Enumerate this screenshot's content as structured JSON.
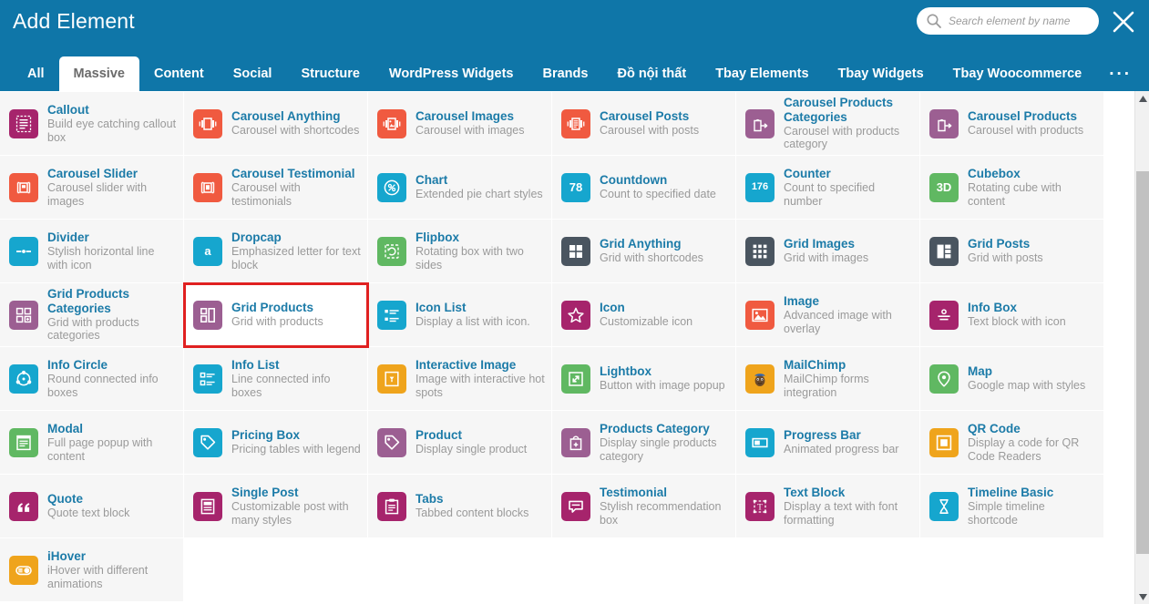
{
  "header": {
    "title": "Add Element",
    "search_placeholder": "Search element by name",
    "search_value": "",
    "close_label": "×",
    "more_tabs_label": "..."
  },
  "tabs": [
    {
      "label": "All",
      "active": false
    },
    {
      "label": "Massive",
      "active": true
    },
    {
      "label": "Content",
      "active": false
    },
    {
      "label": "Social",
      "active": false
    },
    {
      "label": "Structure",
      "active": false
    },
    {
      "label": "WordPress Widgets",
      "active": false
    },
    {
      "label": "Brands",
      "active": false
    },
    {
      "label": "Đồ nội thất",
      "active": false
    },
    {
      "label": "Tbay Elements",
      "active": false
    },
    {
      "label": "Tbay Widgets",
      "active": false
    },
    {
      "label": "Tbay Woocommerce",
      "active": false
    }
  ],
  "colors": {
    "header_blue": "#0f76a8",
    "title_link": "#1c7ba8",
    "desc_gray": "#9a9a9a",
    "selection_red": "#e02020",
    "cell_bg": "#f6f6f6",
    "icon_magenta": "#a6246c",
    "icon_purple": "#9c5f92",
    "icon_orange_red": "#f05a40",
    "icon_cyan": "#16a6ce",
    "icon_green": "#60b862",
    "icon_slate": "#4a5560",
    "icon_amber": "#efa41c"
  },
  "elements": [
    {
      "title": "Callout",
      "desc": "Build eye catching callout box",
      "icon": "callout-icon",
      "color": "#a6246c"
    },
    {
      "title": "Carousel Anything",
      "desc": "Carousel with shortcodes",
      "icon": "carousel-anything-icon",
      "color": "#f05a40"
    },
    {
      "title": "Carousel Images",
      "desc": "Carousel with images",
      "icon": "carousel-images-icon",
      "color": "#f05a40"
    },
    {
      "title": "Carousel Posts",
      "desc": "Carousel with posts",
      "icon": "carousel-posts-icon",
      "color": "#f05a40"
    },
    {
      "title": "Carousel Products Categories",
      "desc": "Carousel with products category",
      "icon": "carousel-products-categories-icon",
      "color": "#9c5f92"
    },
    {
      "title": "Carousel Products",
      "desc": "Carousel with products",
      "icon": "carousel-products-icon",
      "color": "#9c5f92"
    },
    {
      "title": "Carousel Slider",
      "desc": "Carousel slider with images",
      "icon": "carousel-slider-icon",
      "color": "#f05a40"
    },
    {
      "title": "Carousel Testimonial",
      "desc": "Carousel with testimonials",
      "icon": "carousel-testimonial-icon",
      "color": "#f05a40"
    },
    {
      "title": "Chart",
      "desc": "Extended pie chart styles",
      "icon": "chart-percent-icon",
      "color": "#16a6ce"
    },
    {
      "title": "Countdown",
      "desc": "Count to specified date",
      "icon": "countdown-icon",
      "color": "#16a6ce",
      "badge": "78"
    },
    {
      "title": "Counter",
      "desc": "Count to specified number",
      "icon": "counter-icon",
      "color": "#16a6ce",
      "badge": "176"
    },
    {
      "title": "Cubebox",
      "desc": "Rotating cube with content",
      "icon": "cubebox-3d-icon",
      "color": "#60b862",
      "badge": "3D"
    },
    {
      "title": "Divider",
      "desc": "Stylish horizontal line with icon",
      "icon": "divider-icon",
      "color": "#16a6ce"
    },
    {
      "title": "Dropcap",
      "desc": "Emphasized letter for text block",
      "icon": "dropcap-icon",
      "color": "#16a6ce",
      "badge": "a"
    },
    {
      "title": "Flipbox",
      "desc": "Rotating box with two sides",
      "icon": "flipbox-icon",
      "color": "#60b862"
    },
    {
      "title": "Grid Anything",
      "desc": "Grid with shortcodes",
      "icon": "grid-anything-icon",
      "color": "#4a5560"
    },
    {
      "title": "Grid Images",
      "desc": "Grid with images",
      "icon": "grid-images-icon",
      "color": "#4a5560"
    },
    {
      "title": "Grid Posts",
      "desc": "Grid with posts",
      "icon": "grid-posts-icon",
      "color": "#4a5560"
    },
    {
      "title": "Grid Products Categories",
      "desc": "Grid with products categories",
      "icon": "grid-products-categories-icon",
      "color": "#9c5f92"
    },
    {
      "title": "Grid Products",
      "desc": "Grid with products",
      "icon": "grid-products-icon",
      "color": "#9c5f92",
      "selected": true
    },
    {
      "title": "Icon List",
      "desc": "Display a list with icon.",
      "icon": "icon-list-icon",
      "color": "#16a6ce"
    },
    {
      "title": "Icon",
      "desc": "Customizable icon",
      "icon": "star-icon",
      "color": "#a6246c"
    },
    {
      "title": "Image",
      "desc": "Advanced image with overlay",
      "icon": "image-icon",
      "color": "#f05a40"
    },
    {
      "title": "Info Box",
      "desc": "Text block with icon",
      "icon": "info-box-icon",
      "color": "#a6246c"
    },
    {
      "title": "Info Circle",
      "desc": "Round connected info boxes",
      "icon": "info-circle-icon",
      "color": "#16a6ce"
    },
    {
      "title": "Info List",
      "desc": "Line connected info boxes",
      "icon": "info-list-icon",
      "color": "#16a6ce"
    },
    {
      "title": "Interactive Image",
      "desc": "Image with interactive hot spots",
      "icon": "interactive-image-icon",
      "color": "#efa41c"
    },
    {
      "title": "Lightbox",
      "desc": "Button with image popup",
      "icon": "lightbox-icon",
      "color": "#60b862"
    },
    {
      "title": "MailChimp",
      "desc": "MailChimp forms integration",
      "icon": "mailchimp-icon",
      "color": "#efa41c"
    },
    {
      "title": "Map",
      "desc": "Google map with styles",
      "icon": "map-pin-icon",
      "color": "#60b862"
    },
    {
      "title": "Modal",
      "desc": "Full page popup with content",
      "icon": "modal-icon",
      "color": "#60b862"
    },
    {
      "title": "Pricing Box",
      "desc": "Pricing tables with legend",
      "icon": "pricing-box-icon",
      "color": "#16a6ce"
    },
    {
      "title": "Product",
      "desc": "Display single product",
      "icon": "product-tag-icon",
      "color": "#9c5f92"
    },
    {
      "title": "Products Category",
      "desc": "Display single products category",
      "icon": "products-category-icon",
      "color": "#9c5f92"
    },
    {
      "title": "Progress Bar",
      "desc": "Animated progress bar",
      "icon": "progress-bar-icon",
      "color": "#16a6ce"
    },
    {
      "title": "QR Code",
      "desc": "Display a code for QR Code Readers",
      "icon": "qr-code-icon",
      "color": "#efa41c"
    },
    {
      "title": "Quote",
      "desc": "Quote text block",
      "icon": "quote-icon",
      "color": "#a6246c"
    },
    {
      "title": "Single Post",
      "desc": "Customizable post with many styles",
      "icon": "single-post-icon",
      "color": "#a6246c"
    },
    {
      "title": "Tabs",
      "desc": "Tabbed content blocks",
      "icon": "tabs-icon",
      "color": "#a6246c"
    },
    {
      "title": "Testimonial",
      "desc": "Stylish recommendation box",
      "icon": "testimonial-icon",
      "color": "#a6246c"
    },
    {
      "title": "Text Block",
      "desc": "Display a text with font formatting",
      "icon": "text-block-icon",
      "color": "#a6246c"
    },
    {
      "title": "Timeline Basic",
      "desc": "Simple timeline shortcode",
      "icon": "timeline-basic-icon",
      "color": "#16a6ce"
    },
    {
      "title": "iHover",
      "desc": "iHover with different animations",
      "icon": "ihover-icon",
      "color": "#efa41c"
    }
  ]
}
